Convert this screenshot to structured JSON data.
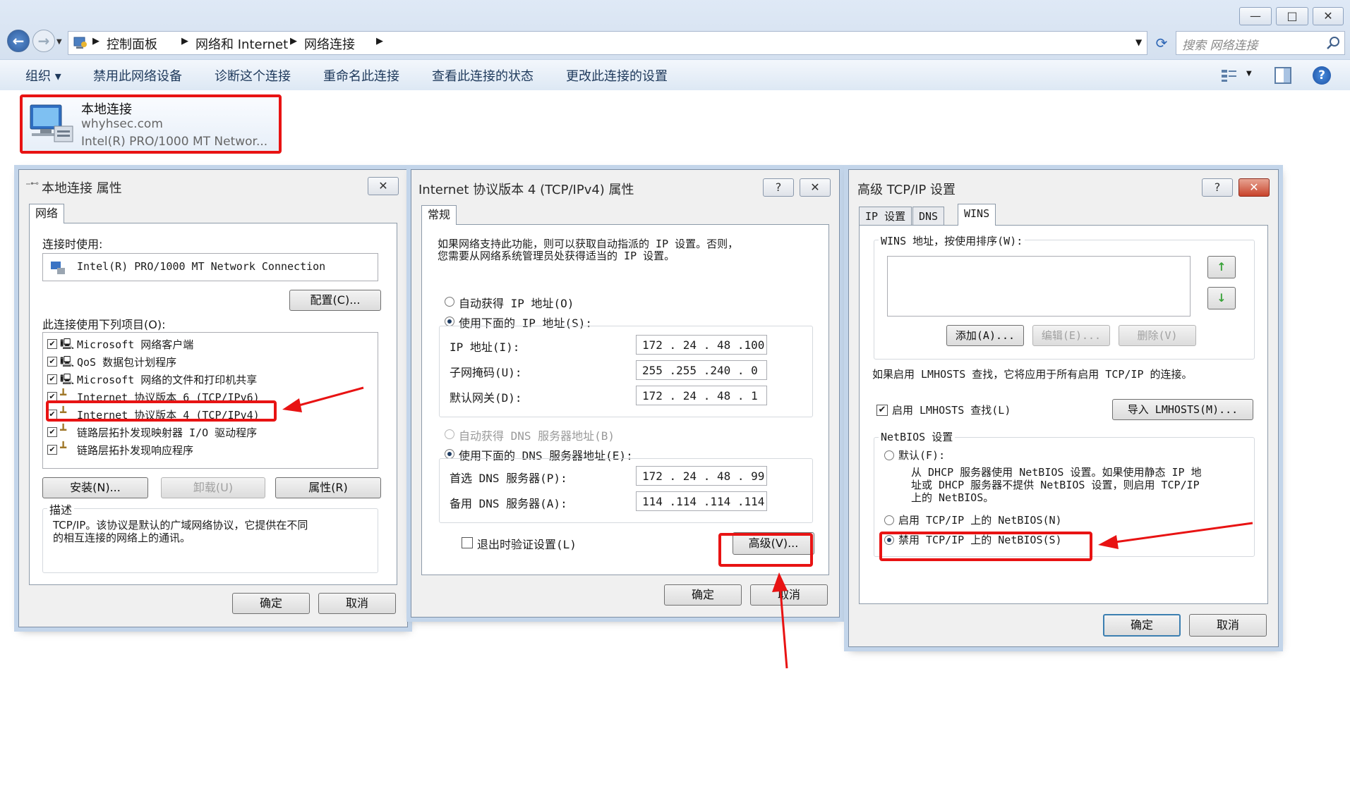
{
  "window": {
    "buttons": {
      "minimize": "—",
      "maximize": "□",
      "close": "✕"
    },
    "nav": {
      "back": "←",
      "forward": "→"
    },
    "breadcrumb": [
      "控制面板",
      "网络和 Internet",
      "网络连接"
    ],
    "search_placeholder": "搜索 网络连接",
    "toolbar": [
      "组织 ▾",
      "禁用此网络设备",
      "诊断这个连接",
      "重命名此连接",
      "查看此连接的状态",
      "更改此连接的设置"
    ]
  },
  "connection": {
    "name": "本地连接",
    "domain": "whyhsec.com",
    "adapter": "Intel(R) PRO/1000 MT Networ..."
  },
  "props": {
    "title": "本地连接 属性",
    "tab": "网络",
    "connect_using_label": "连接时使用:",
    "adapter": "Intel(R) PRO/1000 MT Network Connection",
    "configure": "配置(C)...",
    "items_label": "此连接使用下列项目(O):",
    "items": [
      "Microsoft 网络客户端",
      "QoS 数据包计划程序",
      "Microsoft 网络的文件和打印机共享",
      "Internet 协议版本 6 (TCP/IPv6)",
      "Internet 协议版本 4 (TCP/IPv4)",
      "链路层拓扑发现映射器 I/O 驱动程序",
      "链路层拓扑发现响应程序"
    ],
    "install": "安装(N)...",
    "uninstall": "卸载(U)",
    "properties": "属性(R)",
    "desc_label": "描述",
    "desc_1": "TCP/IP。该协议是默认的广域网络协议，它提供在不同",
    "desc_2": "的相互连接的网络上的通讯。",
    "ok": "确定",
    "cancel": "取消"
  },
  "ipv4": {
    "title": "Internet 协议版本 4 (TCP/IPv4) 属性",
    "help": "?",
    "tab": "常规",
    "intro_1": "如果网络支持此功能，则可以获取自动指派的 IP 设置。否则，",
    "intro_2": "您需要从网络系统管理员处获得适当的 IP 设置。",
    "auto_ip": "自动获得 IP 地址(O)",
    "manual_ip": "使用下面的 IP 地址(S):",
    "ip_label": "IP 地址(I):",
    "ip": "172 . 24  . 48  .100",
    "mask_label": "子网掩码(U):",
    "mask": "255 .255 .240 . 0",
    "gw_label": "默认网关(D):",
    "gw": "172 . 24  . 48  . 1",
    "auto_dns": "自动获得 DNS 服务器地址(B)",
    "manual_dns": "使用下面的 DNS 服务器地址(E):",
    "dns1_label": "首选 DNS 服务器(P):",
    "dns1": "172 . 24  . 48  . 99",
    "dns2_label": "备用 DNS 服务器(A):",
    "dns2": "114 .114 .114 .114",
    "validate": "退出时验证设置(L)",
    "advanced": "高级(V)...",
    "ok": "确定",
    "cancel": "取消"
  },
  "adv": {
    "title": "高级 TCP/IP 设置",
    "help": "?",
    "tabs": [
      "IP 设置",
      "DNS",
      "WINS"
    ],
    "wins_label": "WINS 地址，按使用排序(W):",
    "up": "↑",
    "down": "↓",
    "add": "添加(A)...",
    "edit": "编辑(E)...",
    "remove": "删除(V)",
    "lmhosts_info": "如果启用 LMHOSTS 查找，它将应用于所有启用 TCP/IP 的连接。",
    "lmhosts_enable": "启用 LMHOSTS 查找(L)",
    "import": "导入 LMHOSTS(M)...",
    "netbios_label": "NetBIOS 设置",
    "default": "默认(F):",
    "default_desc_1": "从 DHCP 服务器使用 NetBIOS 设置。如果使用静态 IP 地",
    "default_desc_2": "址或 DHCP 服务器不提供 NetBIOS 设置，则启用 TCP/IP",
    "default_desc_3": "上的 NetBIOS。",
    "enable_netbios": "启用 TCP/IP 上的 NetBIOS(N)",
    "disable_netbios": "禁用 TCP/IP 上的 NetBIOS(S)",
    "ok": "确定",
    "cancel": "取消"
  },
  "annotation_color": "#e81313"
}
